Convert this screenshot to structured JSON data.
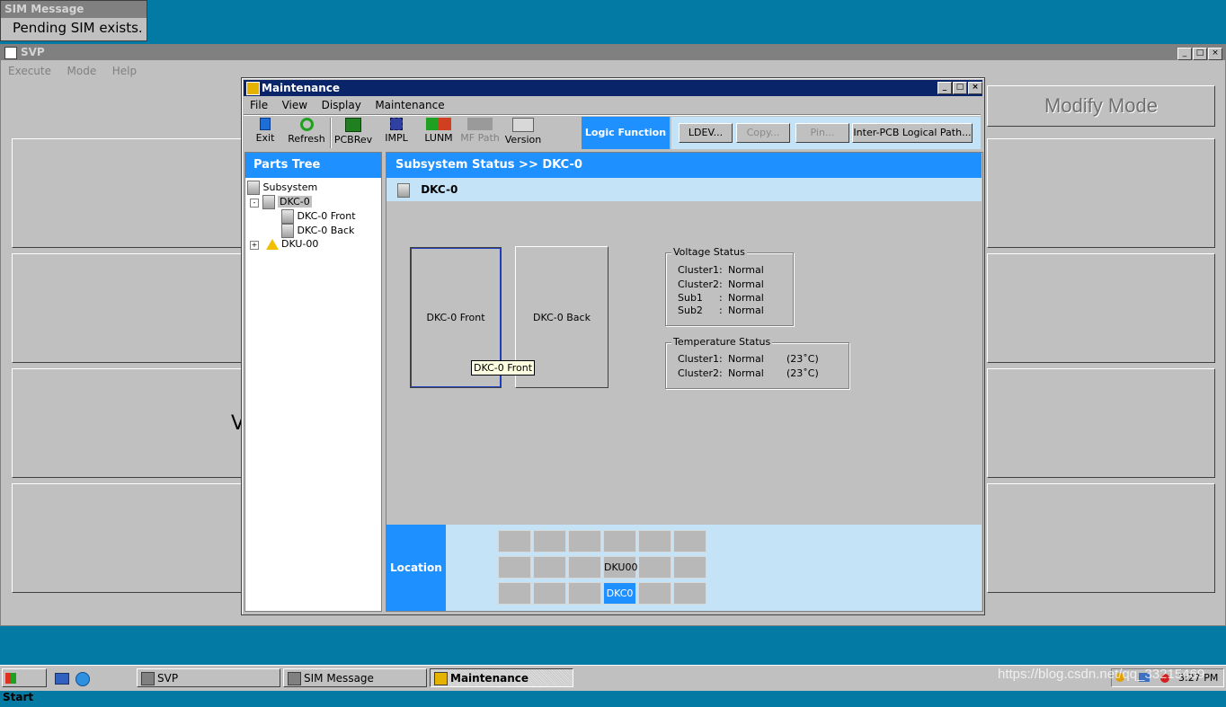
{
  "sim_popup": {
    "title": "SIM Message",
    "message": "Pending SIM exists."
  },
  "svp": {
    "title": "SVP",
    "menu": [
      "Execute",
      "Mode",
      "Help"
    ],
    "mode_button": "Modify Mode",
    "left_partial": "V",
    "window_buttons": [
      "_",
      "□",
      "×"
    ]
  },
  "maintenance": {
    "title": "Maintenance",
    "menu": [
      "File",
      "View",
      "Display",
      "Maintenance"
    ],
    "toolbar": [
      {
        "label": "Exit",
        "icon": "exit-icon",
        "enabled": true
      },
      {
        "label": "Refresh",
        "icon": "refresh-icon",
        "enabled": true
      },
      {
        "label": "PCBRev",
        "icon": "pcbrev-icon",
        "enabled": true
      },
      {
        "label": "IMPL",
        "icon": "chip-icon",
        "enabled": true
      },
      {
        "label": "LUNM",
        "icon": "lunm-icon",
        "enabled": true
      },
      {
        "label": "MF Path",
        "icon": "mf-path-icon",
        "enabled": false
      },
      {
        "label": "Version",
        "icon": "version-icon",
        "enabled": true
      }
    ],
    "logic_function": "Logic Function",
    "logic_buttons": [
      {
        "label": "LDEV...",
        "enabled": true
      },
      {
        "label": "Copy...",
        "enabled": false
      },
      {
        "label": "Pin...",
        "enabled": false
      },
      {
        "label": "Inter-PCB Logical Path...",
        "enabled": true
      }
    ],
    "parts_tree": {
      "header": "Parts Tree",
      "nodes": [
        "Subsystem",
        "DKC-0",
        "DKC-0 Front",
        "DKC-0 Back",
        "DKU-00"
      ]
    },
    "status": {
      "header": "Subsystem Status >> DKC-0",
      "subheader": "DKC-0",
      "front_button": "DKC-0 Front",
      "back_button": "DKC-0 Back",
      "tooltip": "DKC-0 Front",
      "voltage": {
        "title": "Voltage Status",
        "rows": [
          {
            "name": "Cluster1",
            "sep": ":",
            "value": "Normal"
          },
          {
            "name": "Cluster2",
            "sep": ":",
            "value": "Normal"
          },
          {
            "name": "Sub1",
            "sep": ":",
            "value": "Normal"
          },
          {
            "name": "Sub2",
            "sep": ":",
            "value": "Normal"
          }
        ]
      },
      "temperature": {
        "title": "Temperature Status",
        "rows": [
          {
            "name": "Cluster1",
            "sep": ":",
            "value": "Normal",
            "temp": "(23˚C)"
          },
          {
            "name": "Cluster2",
            "sep": ":",
            "value": "Normal",
            "temp": "(23˚C)"
          }
        ]
      },
      "location": {
        "label": "Location",
        "grid": [
          [
            "",
            "",
            "",
            "",
            "",
            ""
          ],
          [
            "",
            "",
            "",
            "DKU00",
            "",
            ""
          ],
          [
            "",
            "",
            "",
            "DKC0",
            "",
            ""
          ]
        ],
        "selected": "DKC0"
      }
    }
  },
  "taskbar": {
    "start": "Start",
    "tasks": [
      "SVP",
      "SIM Message",
      "Maintenance"
    ],
    "active_task": "Maintenance",
    "clock": "3:27 PM",
    "watermark": "https://blog.csdn.net/qq_33215469"
  },
  "colors": {
    "desktop": "#037aa3",
    "title_active": "#0a246a",
    "accent_blue": "#1e90ff",
    "light_blue": "#c4e3f6"
  }
}
